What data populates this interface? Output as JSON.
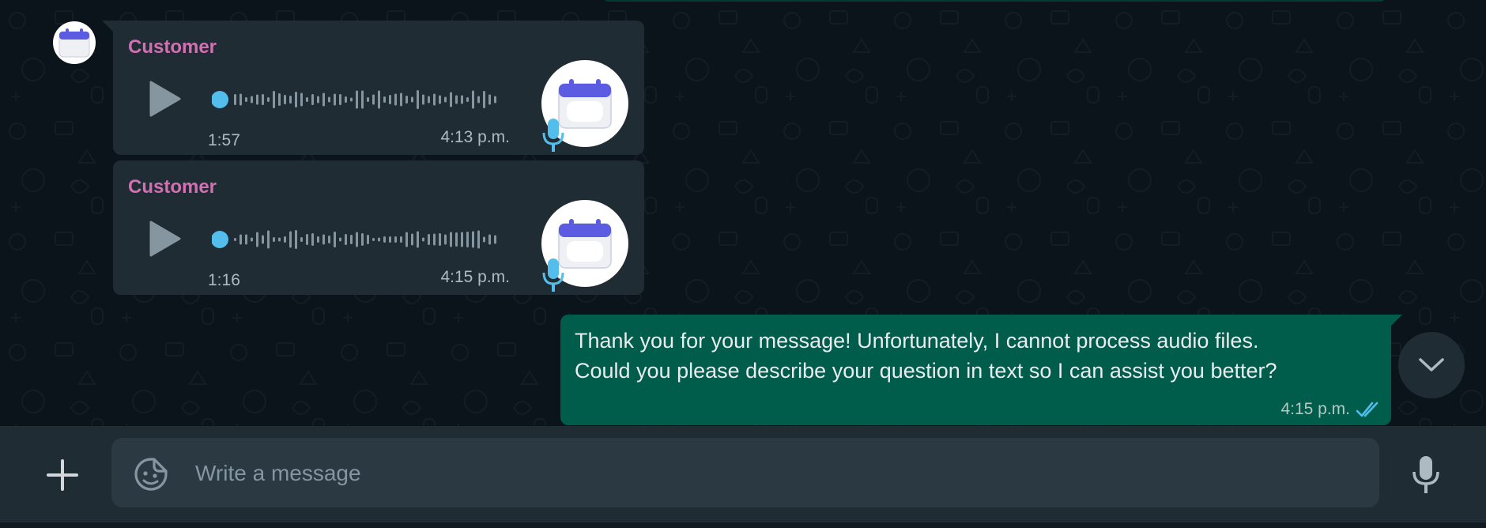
{
  "messages": [
    {
      "sender": "Customer",
      "duration": "1:57",
      "time": "4:13 p.m."
    },
    {
      "sender": "Customer",
      "duration": "1:16",
      "time": "4:15 p.m."
    }
  ],
  "outgoing": {
    "lines": [
      "Thank you for your message! Unfortunately, I cannot process audio files.",
      "Could you please describe your question in text so I can assist you better?"
    ],
    "time": "4:15 p.m.",
    "status": "read"
  },
  "composer": {
    "placeholder": "Write a message",
    "value": ""
  },
  "colors": {
    "background": "#0b141a",
    "incoming_bubble": "#202c33",
    "outgoing_bubble": "#005c4b",
    "sender_name": "#d36fb3",
    "playback_dot": "#53bdeb",
    "read_ticks": "#53bdeb"
  },
  "icons": {
    "avatar": "calendar-icon",
    "play": "play-icon",
    "voice_badge": "mic-icon",
    "scroll": "chevron-down-icon",
    "add": "plus-icon",
    "sticker": "sticker-icon",
    "record": "mic-icon",
    "status": "double-check-icon"
  }
}
